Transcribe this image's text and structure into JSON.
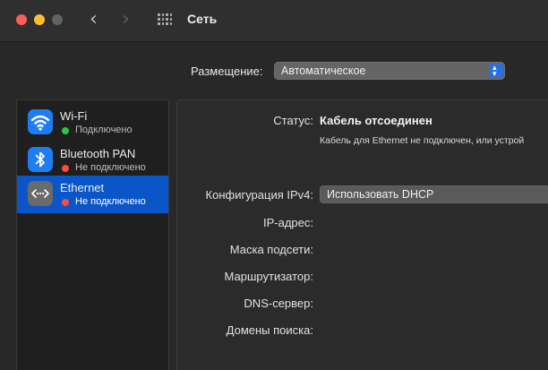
{
  "window": {
    "title": "Сеть",
    "nav_back": "‹",
    "nav_forward": "›"
  },
  "location": {
    "label": "Размещение:",
    "value": "Автоматическое"
  },
  "services": [
    {
      "name": "Wi-Fi",
      "status": "Подключено",
      "status_color": "#28c840",
      "icon": "wifi-icon",
      "selected": false
    },
    {
      "name": "Bluetooth PAN",
      "status": "Не подключено",
      "status_color": "#ff4a3d",
      "icon": "bluetooth-icon",
      "selected": false
    },
    {
      "name": "Ethernet",
      "status": "Не подключено",
      "status_color": "#ff4a3d",
      "icon": "ethernet-icon",
      "selected": true
    }
  ],
  "detail": {
    "status_label": "Статус:",
    "status_value": "Кабель отсоединен",
    "status_description": "Кабель для Ethernet не подключен, или устрой",
    "config_label": "Конфигурация IPv4:",
    "config_value": "Использовать DHCP",
    "ip_label": "IP-адрес:",
    "mask_label": "Маска подсети:",
    "router_label": "Маршрутизатор:",
    "dns_label": "DNS-сервер:",
    "search_domains_label": "Домены поиска:"
  },
  "colors": {
    "accent": "#0a56c9",
    "select_accent": "#2a6fe0"
  }
}
